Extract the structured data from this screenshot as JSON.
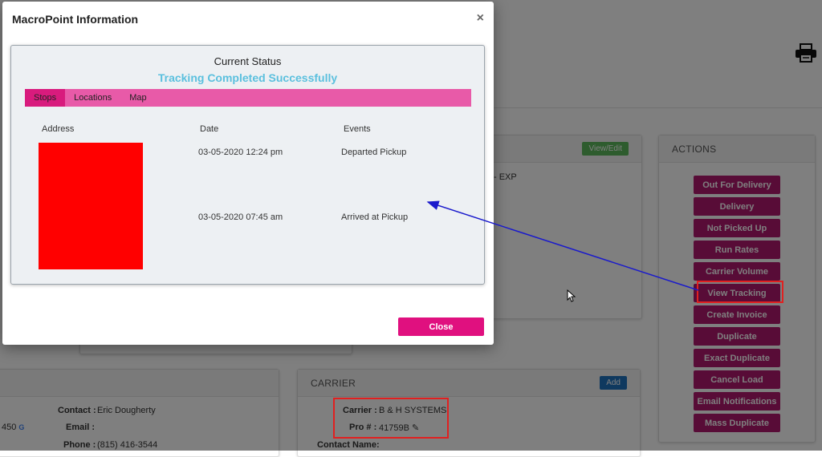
{
  "modal": {
    "title": "MacroPoint Information",
    "close_icon": "×",
    "status_heading": "Current Status",
    "status_message": "Tracking Completed Successfully",
    "tabs": [
      {
        "label": "Stops",
        "active": true
      },
      {
        "label": "Locations",
        "active": false
      },
      {
        "label": "Map",
        "active": false
      }
    ],
    "columns": [
      "Address",
      "Date",
      "Events"
    ],
    "rows": [
      {
        "date": "03-05-2020 12:24 pm",
        "event": "Departed Pickup"
      },
      {
        "date": "03-05-2020 07:45 am",
        "event": "Arrived at Pickup"
      }
    ],
    "close_label": "Close"
  },
  "background": {
    "view_edit_label": "View/Edit",
    "partial_text": "ck- EXP",
    "actions": {
      "title": "ACTIONS",
      "buttons": [
        "Out For Delivery",
        "Delivery",
        "Not Picked Up",
        "Run Rates",
        "Carrier Volume",
        "View Tracking",
        "Create Invoice",
        "Duplicate",
        "Exact Duplicate",
        "Cancel Load",
        "Email Notifications",
        "Mass Duplicate"
      ]
    },
    "contact": {
      "contact_label": "Contact :",
      "contact_value": "Eric Dougherty",
      "email_label": "Email :",
      "phone_label": "Phone :",
      "phone_value": "(815) 416-3544",
      "partial_number": "450"
    },
    "carrier": {
      "title": "CARRIER",
      "add_label": "Add",
      "carrier_label": "Carrier :",
      "carrier_value": "B & H SYSTEMS",
      "pro_label": "Pro # :",
      "pro_value": "41759B",
      "contact_name_label": "Contact Name:"
    }
  },
  "colors": {
    "accent": "#e0107f",
    "tab_bar": "#e85aa8",
    "action_button": "#b0186f",
    "status_text": "#5bc0de",
    "annotation_box": "#e02020",
    "annotation_arrow": "#1a1acc"
  }
}
